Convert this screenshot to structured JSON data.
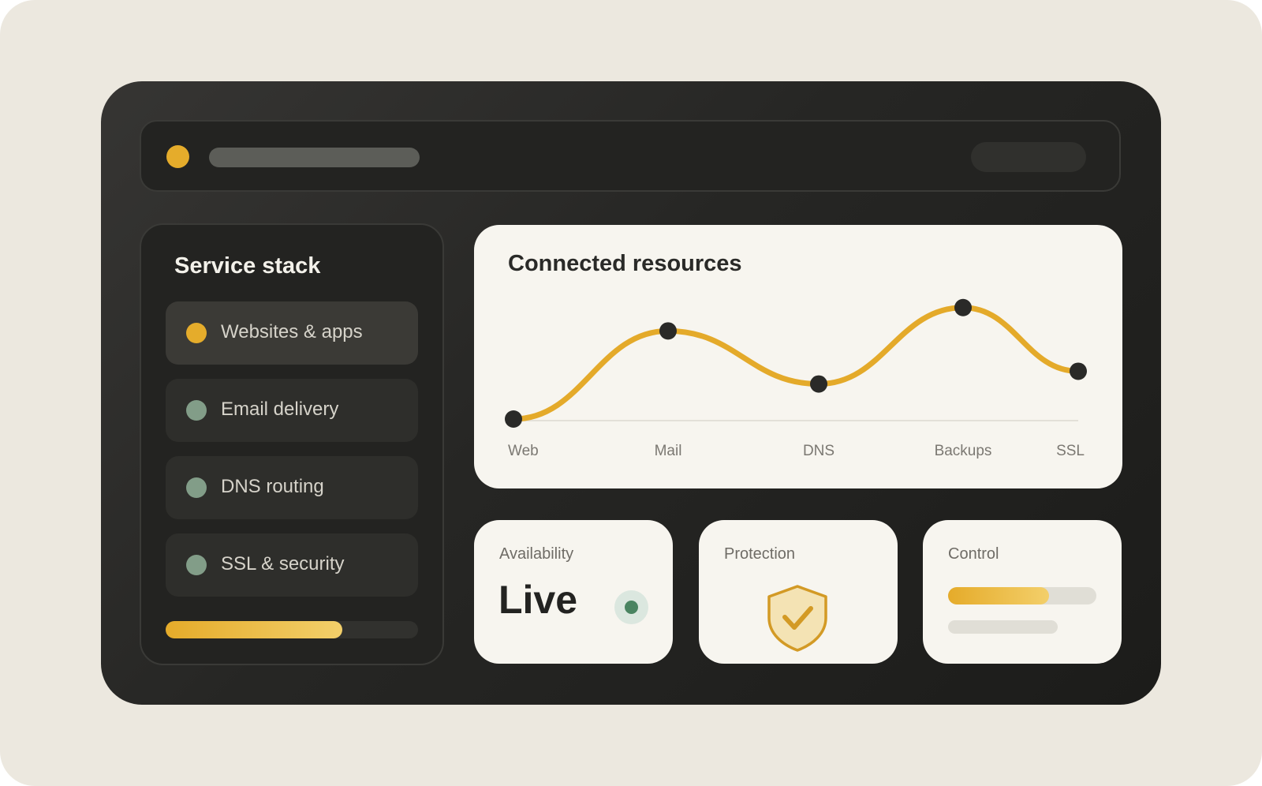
{
  "sidebar": {
    "title": "Service stack",
    "items": [
      {
        "label": "Websites & apps",
        "status_color": "#e5ac2b",
        "active": true
      },
      {
        "label": "Email delivery",
        "status_color": "#829d88",
        "active": false
      },
      {
        "label": "DNS routing",
        "status_color": "#829d88",
        "active": false
      },
      {
        "label": "SSL & security",
        "status_color": "#829d88",
        "active": false
      }
    ],
    "progress": 0.7
  },
  "chart": {
    "title": "Connected resources"
  },
  "chart_data": {
    "type": "line",
    "title": "Connected resources",
    "categories": [
      "Web",
      "Mail",
      "DNS",
      "Backups",
      "SSL"
    ],
    "series": [
      {
        "values": [
          0,
          0.83,
          0.33,
          1.05,
          0.45
        ]
      }
    ],
    "ylim": [
      0,
      1.1
    ],
    "grid": false,
    "line_color": "#e4aa2a"
  },
  "cards": {
    "availability": {
      "title": "Availability",
      "value": "Live",
      "indicator_color": "#4a8461"
    },
    "protection": {
      "title": "Protection",
      "icon": "shield-check-icon"
    },
    "control": {
      "title": "Control",
      "progress": 0.68
    }
  },
  "colors": {
    "accent": "#e5ac2b",
    "background": "#ece8df",
    "panel_dark": "#232321",
    "card_light": "#f7f5ef"
  }
}
